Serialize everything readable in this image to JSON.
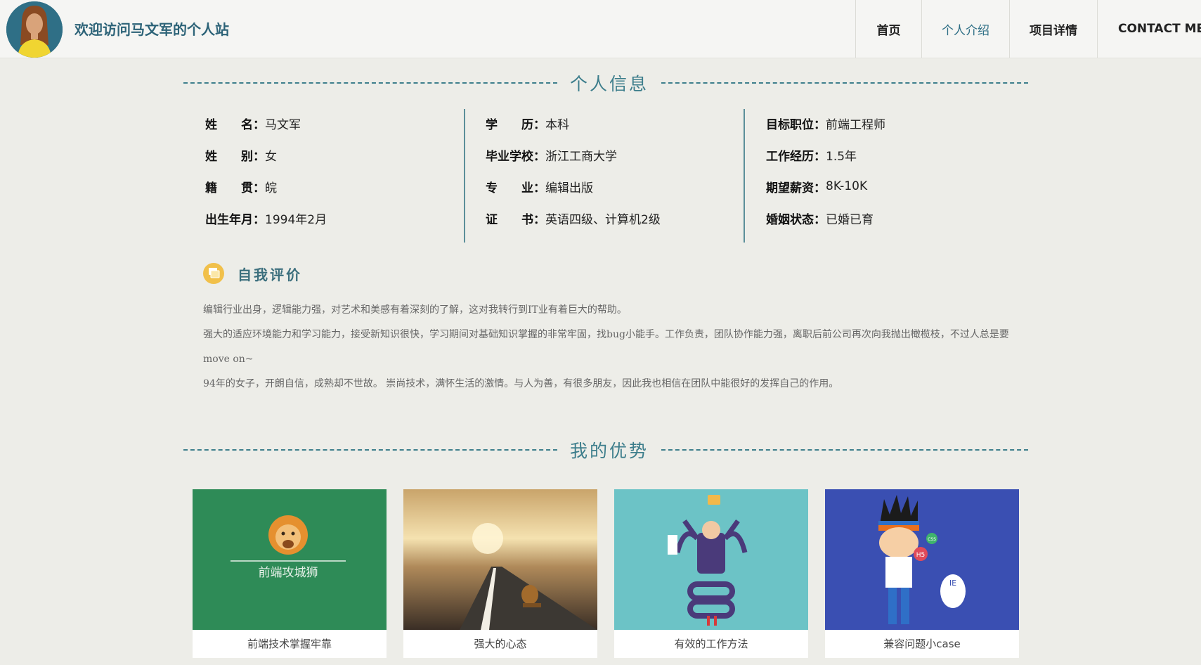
{
  "header": {
    "site_title": "欢迎访问马文军的个人站",
    "nav": [
      {
        "label": "首页"
      },
      {
        "label": "个人介绍"
      },
      {
        "label": "项目详情"
      },
      {
        "label": "CONTACT ME"
      }
    ]
  },
  "info": {
    "heading": "个人信息",
    "col1": [
      {
        "label": "姓　　名：",
        "value": "马文军"
      },
      {
        "label": "姓　　别：",
        "value": "女"
      },
      {
        "label": "籍　　贯：",
        "value": "皖"
      },
      {
        "label": "出生年月：",
        "value": "1994年2月"
      }
    ],
    "col2": [
      {
        "label": "学　　历：",
        "value": "本科"
      },
      {
        "label": "毕业学校：",
        "value": "浙江工商大学"
      },
      {
        "label": "专　　业：",
        "value": "编辑出版"
      },
      {
        "label": "证　　书：",
        "value": "英语四级、计算机2级"
      }
    ],
    "col3": [
      {
        "label": "目标职位：",
        "value": "前端工程师"
      },
      {
        "label": "工作经历：",
        "value": "1.5年"
      },
      {
        "label": "期望薪资：",
        "value": "8K-10K"
      },
      {
        "label": "婚姻状态：",
        "value": "已婚已育"
      }
    ]
  },
  "evaluation": {
    "title": "自我评价",
    "paragraphs": [
      "编辑行业出身，逻辑能力强，对艺术和美感有着深刻的了解，这对我转行到IT业有着巨大的帮助。",
      "强大的适应环境能力和学习能力，接受新知识很快，学习期间对基础知识掌握的非常牢固，找bug小能手。工作负责，团队协作能力强，离职后前公司再次向我抛出橄榄枝，不过人总是要move on~",
      "94年的女子，开朗自信，成熟却不世故。 崇尚技术，满怀生活的激情。与人为善，有很多朋友，因此我也相信在团队中能很好的发挥自己的作用。"
    ]
  },
  "advantages": {
    "heading": "我的优势",
    "cards": [
      {
        "caption": "前端技术掌握牢靠",
        "image_text": "前端攻城狮",
        "bg": "#2e8b57"
      },
      {
        "caption": "强大的心态",
        "bg": "#8a6a3c"
      },
      {
        "caption": "有效的工作方法",
        "bg": "#6cc3c6"
      },
      {
        "caption": "兼容问题小case",
        "badge_h5": "H5",
        "badge_css": "CSS",
        "badge_ie": "IE",
        "bg": "#3a4fb2"
      }
    ]
  },
  "colors": {
    "accent": "#3c7d8b",
    "page_bg": "#edede8",
    "title": "#2d6378"
  }
}
